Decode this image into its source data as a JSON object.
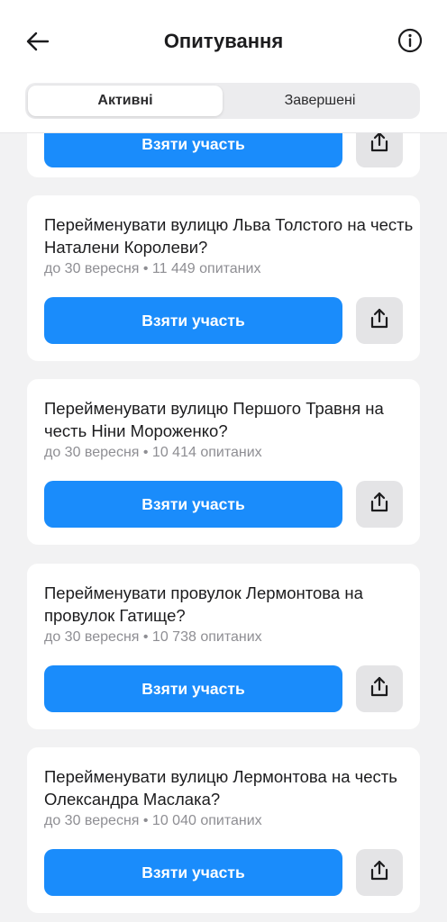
{
  "header": {
    "title": "Опитування"
  },
  "tabs": [
    {
      "label": "Активні",
      "active": true
    },
    {
      "label": "Завершені",
      "active": false
    }
  ],
  "partial_card": {
    "button_label": "Взяти участь"
  },
  "polls": [
    {
      "title": "Перейменувати вулицю Льва Толстого на честь Наталени Королеви?",
      "meta": "до 30 вересня • 11 449 опитаних",
      "button_label": "Взяти участь"
    },
    {
      "title": "Перейменувати вулицю Першого Травня на честь Ніни Мороженко?",
      "meta": "до 30 вересня • 10 414 опитаних",
      "button_label": "Взяти участь"
    },
    {
      "title": "Перейменувати провулок Лермонтова на провулок Гатище?",
      "meta": "до 30 вересня • 10 738 опитаних",
      "button_label": "Взяти участь"
    },
    {
      "title": "Перейменувати вулицю Лермонтова на честь Олександра Маслака?",
      "meta": "до 30 вересня • 10 040 опитаних",
      "button_label": "Взяти участь"
    }
  ],
  "icons": {
    "back": "arrow-left-icon",
    "info": "info-icon",
    "share": "share-icon"
  },
  "colors": {
    "accent": "#1a8cfb",
    "background": "#f2f2f3",
    "card": "#ffffff",
    "meta_text": "#8e8e93",
    "share_bg": "#e4e4e6"
  }
}
